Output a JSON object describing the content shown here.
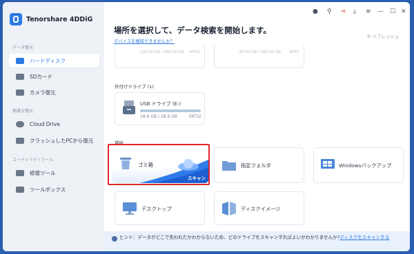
{
  "app": {
    "name": "Tenorshare 4DDiG"
  },
  "sidebar": {
    "sections": [
      {
        "title": "データ復元",
        "items": [
          {
            "label": "ハードディスク",
            "active": true
          },
          {
            "label": "SDカード"
          },
          {
            "label": "カメラ復元"
          }
        ]
      },
      {
        "title": "高度な復元",
        "items": [
          {
            "label": "Cloud Drive"
          },
          {
            "label": "クラッシュしたPCから復元"
          }
        ]
      },
      {
        "title": "ユーティリティツール",
        "items": [
          {
            "label": "修復ツール"
          },
          {
            "label": "ツールボックス"
          }
        ]
      }
    ]
  },
  "header": {
    "title": "場所を選択して、データ検索を開始します。",
    "detect_link": "デバイスを検知できませんか？",
    "refresh": "リフレッシュ"
  },
  "partial_drives": [
    {
      "size": "120.00 GB / 400.00 GB",
      "fs": "NTFS"
    },
    {
      "size": "85.00 GB / 200.00 GB",
      "fs": "NTFS"
    }
  ],
  "external": {
    "section_title": "外付けドライブ (1)",
    "drive": {
      "name": "USB ドライブ (E:)",
      "size": "28.9 GB / 28.9 GB",
      "fs": "FAT32",
      "usage_fraction": 1.0
    }
  },
  "locations": {
    "section_title": "場所",
    "items": [
      {
        "label": "ゴミ箱",
        "scan_label": "スキャン"
      },
      {
        "label": "指定フォルダ"
      },
      {
        "label": "Windowsバックアップ"
      },
      {
        "label": "デスクトップ"
      },
      {
        "label": "ディスクイメージ"
      }
    ]
  },
  "footer": {
    "hint": "ヒント：データがどこで失われたかわからないため、どのドライブをスキャンすればよいかわかりませんか?",
    "link": "ディスクをスキャンする"
  },
  "colors": {
    "accent": "#2c7be5",
    "highlight": "#e0242a"
  }
}
